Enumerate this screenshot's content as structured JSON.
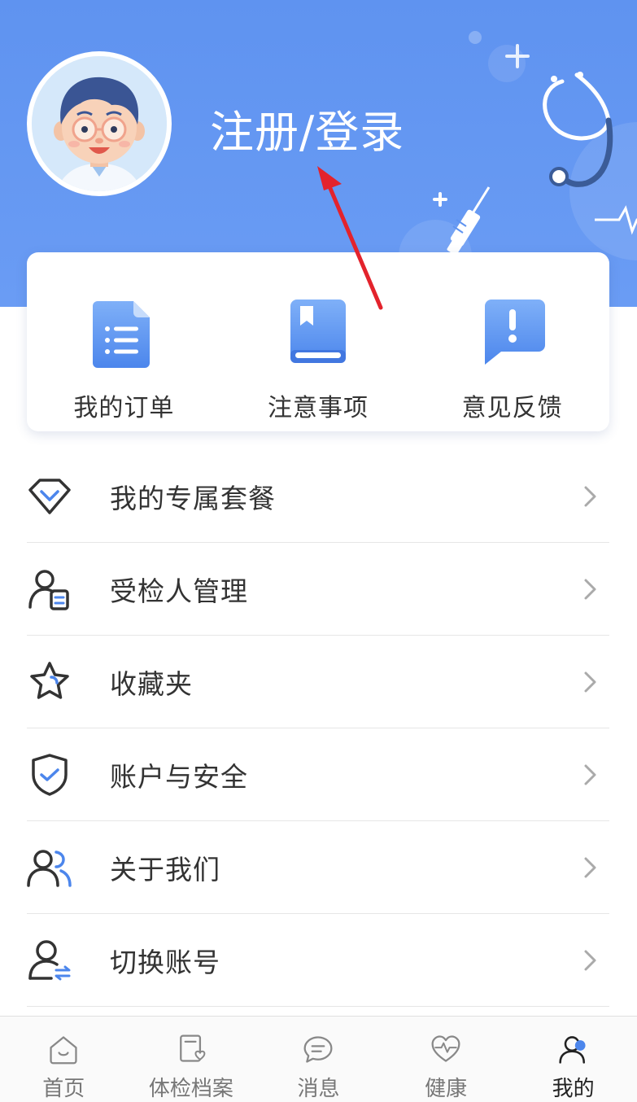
{
  "header": {
    "login_label": "注册/登录",
    "accent_color": "#6399f3"
  },
  "quick_actions": [
    {
      "label": "我的订单",
      "icon": "document-list-icon"
    },
    {
      "label": "注意事项",
      "icon": "book-icon"
    },
    {
      "label": "意见反馈",
      "icon": "feedback-icon"
    }
  ],
  "menu": [
    {
      "label": "我的专属套餐",
      "icon": "diamond-icon"
    },
    {
      "label": "受检人管理",
      "icon": "user-card-icon"
    },
    {
      "label": "收藏夹",
      "icon": "star-icon"
    },
    {
      "label": "账户与安全",
      "icon": "shield-check-icon"
    },
    {
      "label": "关于我们",
      "icon": "users-icon"
    },
    {
      "label": "切换账号",
      "icon": "switch-user-icon"
    }
  ],
  "tabbar": [
    {
      "label": "首页",
      "icon": "home-icon",
      "active": false
    },
    {
      "label": "体检档案",
      "icon": "health-record-icon",
      "active": false
    },
    {
      "label": "消息",
      "icon": "message-icon",
      "active": false
    },
    {
      "label": "健康",
      "icon": "heart-pulse-icon",
      "active": false
    },
    {
      "label": "我的",
      "icon": "profile-icon",
      "active": true
    }
  ]
}
